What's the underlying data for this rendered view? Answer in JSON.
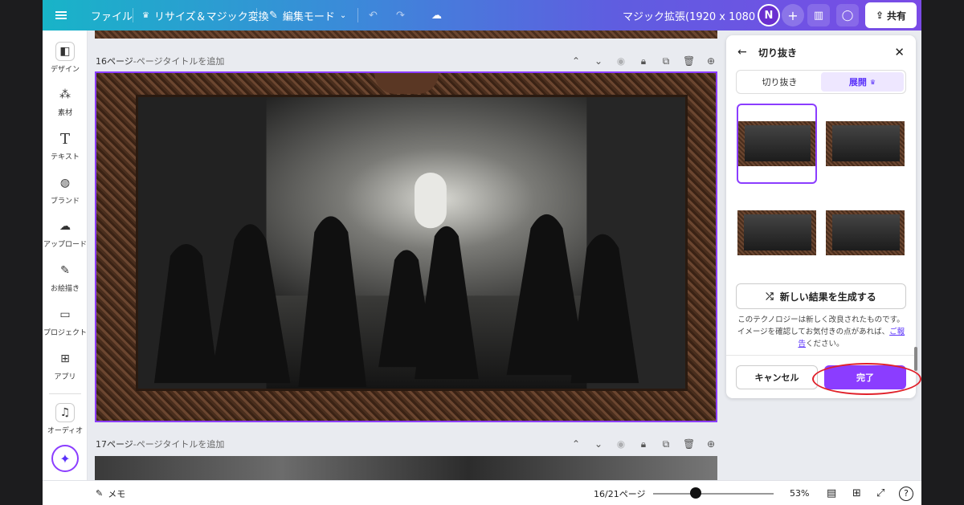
{
  "topbar": {
    "file": "ファイル",
    "resize": "リサイズ＆マジック変換",
    "edit_mode": "編集モード",
    "doc_title": "マジック拡張(1920 x 1080 px)",
    "avatar": "N",
    "share": "共有"
  },
  "rail": {
    "items": [
      {
        "label": "デザイン",
        "icon": "design-icon"
      },
      {
        "label": "素材",
        "icon": "elements-icon"
      },
      {
        "label": "テキスト",
        "icon": "text-icon"
      },
      {
        "label": "ブランド",
        "icon": "brand-icon"
      },
      {
        "label": "アップロード",
        "icon": "upload-icon"
      },
      {
        "label": "お絵描き",
        "icon": "draw-icon"
      },
      {
        "label": "プロジェクト",
        "icon": "folder-icon"
      },
      {
        "label": "アプリ",
        "icon": "apps-icon"
      },
      {
        "label": "オーディオ",
        "icon": "music-icon"
      }
    ]
  },
  "pages": {
    "p16": {
      "num": "16ページ",
      "sep": " - ",
      "title": "ページタイトルを追加"
    },
    "p17": {
      "num": "17ページ",
      "sep": " - ",
      "title": "ページタイトルを追加"
    }
  },
  "panel": {
    "title": "切り抜き",
    "tabs": [
      {
        "label": "切り抜き",
        "active": false
      },
      {
        "label": "展開",
        "active": true
      }
    ],
    "generate": "新しい結果を生成する",
    "disclaimer_pre": "このテクノロジーは新しく改良されたものです。イメージを確認してお気付きの点があれば、",
    "disclaimer_link": "ご報告",
    "disclaimer_post": "ください。",
    "cancel": "キャンセル",
    "done": "完了"
  },
  "bottombar": {
    "notes": "メモ",
    "page_counter": "16/21ページ",
    "zoom": "53%",
    "zoom_value": 0.53
  },
  "colors": {
    "accent": "#8b3dff",
    "highlight": "#e0202a"
  }
}
